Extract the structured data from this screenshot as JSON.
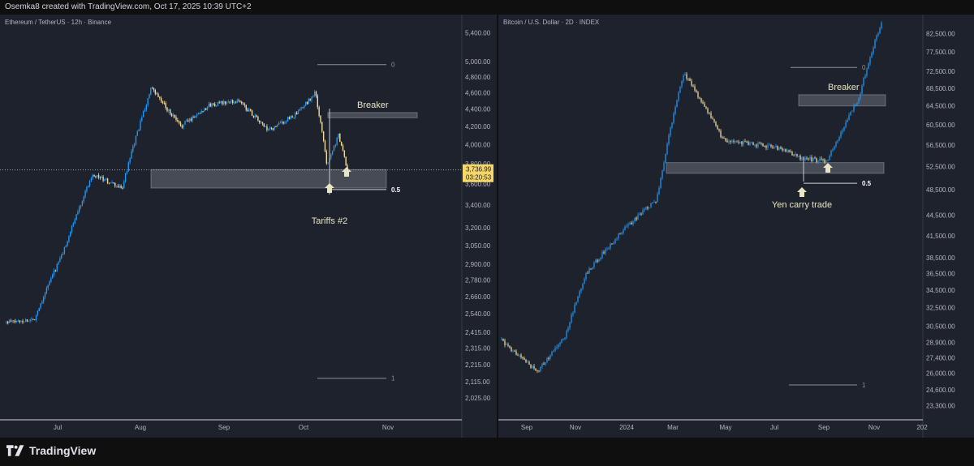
{
  "header": {
    "attribution": "Osemka8 created with TradingView.com, Oct 17, 2025 10:39 UTC+2"
  },
  "footer": {
    "brand": "TradingView",
    "logo_icon": "tradingview-logo-icon"
  },
  "colors": {
    "background": "#1e222d",
    "up": "#2196f3",
    "down": "#f0dca0",
    "zone": "#9ea3ad",
    "annotation": "#e8e5c4"
  },
  "chart_data": [
    {
      "type": "candlestick",
      "title": "Ethereum / TetherUS · 12h · Binance",
      "x_ticks": [
        "Jul",
        "Aug",
        "Sep",
        "Oct",
        "Nov"
      ],
      "y_ticks": [
        "5,400.00",
        "5,000.00",
        "4,800.00",
        "4,600.00",
        "4,400.00",
        "4,200.00",
        "4,000.00",
        "3,800.00",
        "3,600.00",
        "3,400.00",
        "3,200.00",
        "3,050.00",
        "2,900.00",
        "2,780.00",
        "2,660.00",
        "2,540.00",
        "2,415.00",
        "2,315.00",
        "2,215.00",
        "2,115.00",
        "2,025.00"
      ],
      "y_scale": "log",
      "ylim": [
        1960,
        5600
      ],
      "price_label": "3,736.99",
      "countdown_label": "03:20:53",
      "series": [
        {
          "x": [
            "Jun 22",
            "Jul 2",
            "Jul 12",
            "Jul 22",
            "Aug 1",
            "Aug 11",
            "Aug 21",
            "Aug 31",
            "Sep 10",
            "Sep 20",
            "Sep 30",
            "Oct 6",
            "Oct 10",
            "Oct 14",
            "Oct 17"
          ],
          "close": [
            2480,
            2500,
            3000,
            3700,
            3550,
            4650,
            4200,
            4450,
            4500,
            4150,
            4350,
            4600,
            3800,
            4100,
            3737
          ]
        }
      ],
      "annotations": [
        {
          "text": "Breaker",
          "kind": "zone",
          "from": 4300,
          "to": 4360
        },
        {
          "kind": "zone",
          "from": 3560,
          "to": 3740
        },
        {
          "text": "Tariffs #2",
          "kind": "arrow"
        },
        {
          "text": "0",
          "kind": "level",
          "value": 4960
        },
        {
          "text": "0.5",
          "kind": "level",
          "value": 3545
        },
        {
          "text": "1",
          "kind": "level",
          "value": 2135
        }
      ]
    },
    {
      "type": "candlestick",
      "title": "Bitcoin / U.S. Dollar · 2D · INDEX",
      "x_ticks": [
        "Sep",
        "Nov",
        "2024",
        "Mar",
        "May",
        "Jul",
        "Sep",
        "Nov",
        "202"
      ],
      "y_ticks": [
        "82,500.00",
        "77,500.00",
        "72,500.00",
        "68,500.00",
        "64,500.00",
        "60,500.00",
        "56,500.00",
        "52,500.00",
        "48,500.00",
        "44,500.00",
        "41,500.00",
        "38,500.00",
        "36,500.00",
        "34,500.00",
        "32,500.00",
        "30,500.00",
        "28,900.00",
        "27,400.00",
        "26,000.00",
        "24,600.00",
        "23,300.00"
      ],
      "y_scale": "log",
      "ylim": [
        22700,
        87000
      ],
      "series": [
        {
          "x": [
            "Aug 1 2023",
            "Sep 15 2023",
            "Oct 20 2023",
            "Nov 15 2023",
            "Dec 31 2023",
            "Feb 10 2024",
            "Mar 14 2024",
            "May 1 2024",
            "Jul 5 2024",
            "Aug 5 2024",
            "Sep 6 2024",
            "Oct 15 2024",
            "Nov 12 2024"
          ],
          "close": [
            29200,
            26100,
            29500,
            36500,
            42300,
            47000,
            72000,
            57500,
            56000,
            54000,
            53500,
            66000,
            86000
          ]
        }
      ],
      "annotations": [
        {
          "text": "Breaker",
          "kind": "zone",
          "from": 64500,
          "to": 67000
        },
        {
          "kind": "zone",
          "from": 51300,
          "to": 53200
        },
        {
          "text": "Yen carry trade",
          "kind": "arrow"
        },
        {
          "text": "0",
          "kind": "level",
          "value": 73500
        },
        {
          "text": "0.5",
          "kind": "level",
          "value": 49600
        },
        {
          "text": "1",
          "kind": "level",
          "value": 25000
        }
      ]
    }
  ]
}
